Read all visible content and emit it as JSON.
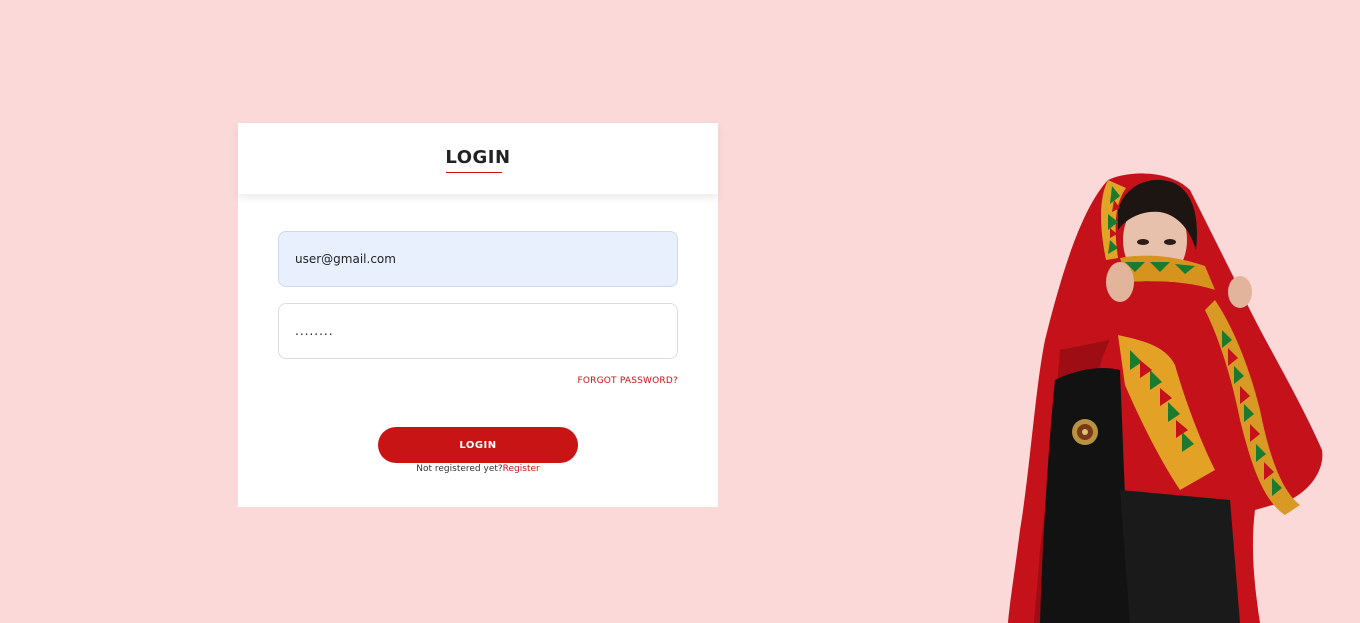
{
  "login_card": {
    "title": "LOGIN",
    "email_value": "user@gmail.com",
    "password_value": "........",
    "forgot_label": "FORGOT PASSWORD?",
    "login_button_label": "LOGIN",
    "register_prompt": "Not registered yet?",
    "register_link": "Register"
  },
  "colors": {
    "background": "#fbd9d9",
    "accent": "#c81414",
    "autofill_field": "#e8f0fe"
  },
  "illustration": {
    "subject": "woman in red embroidered dress with headscarf"
  }
}
